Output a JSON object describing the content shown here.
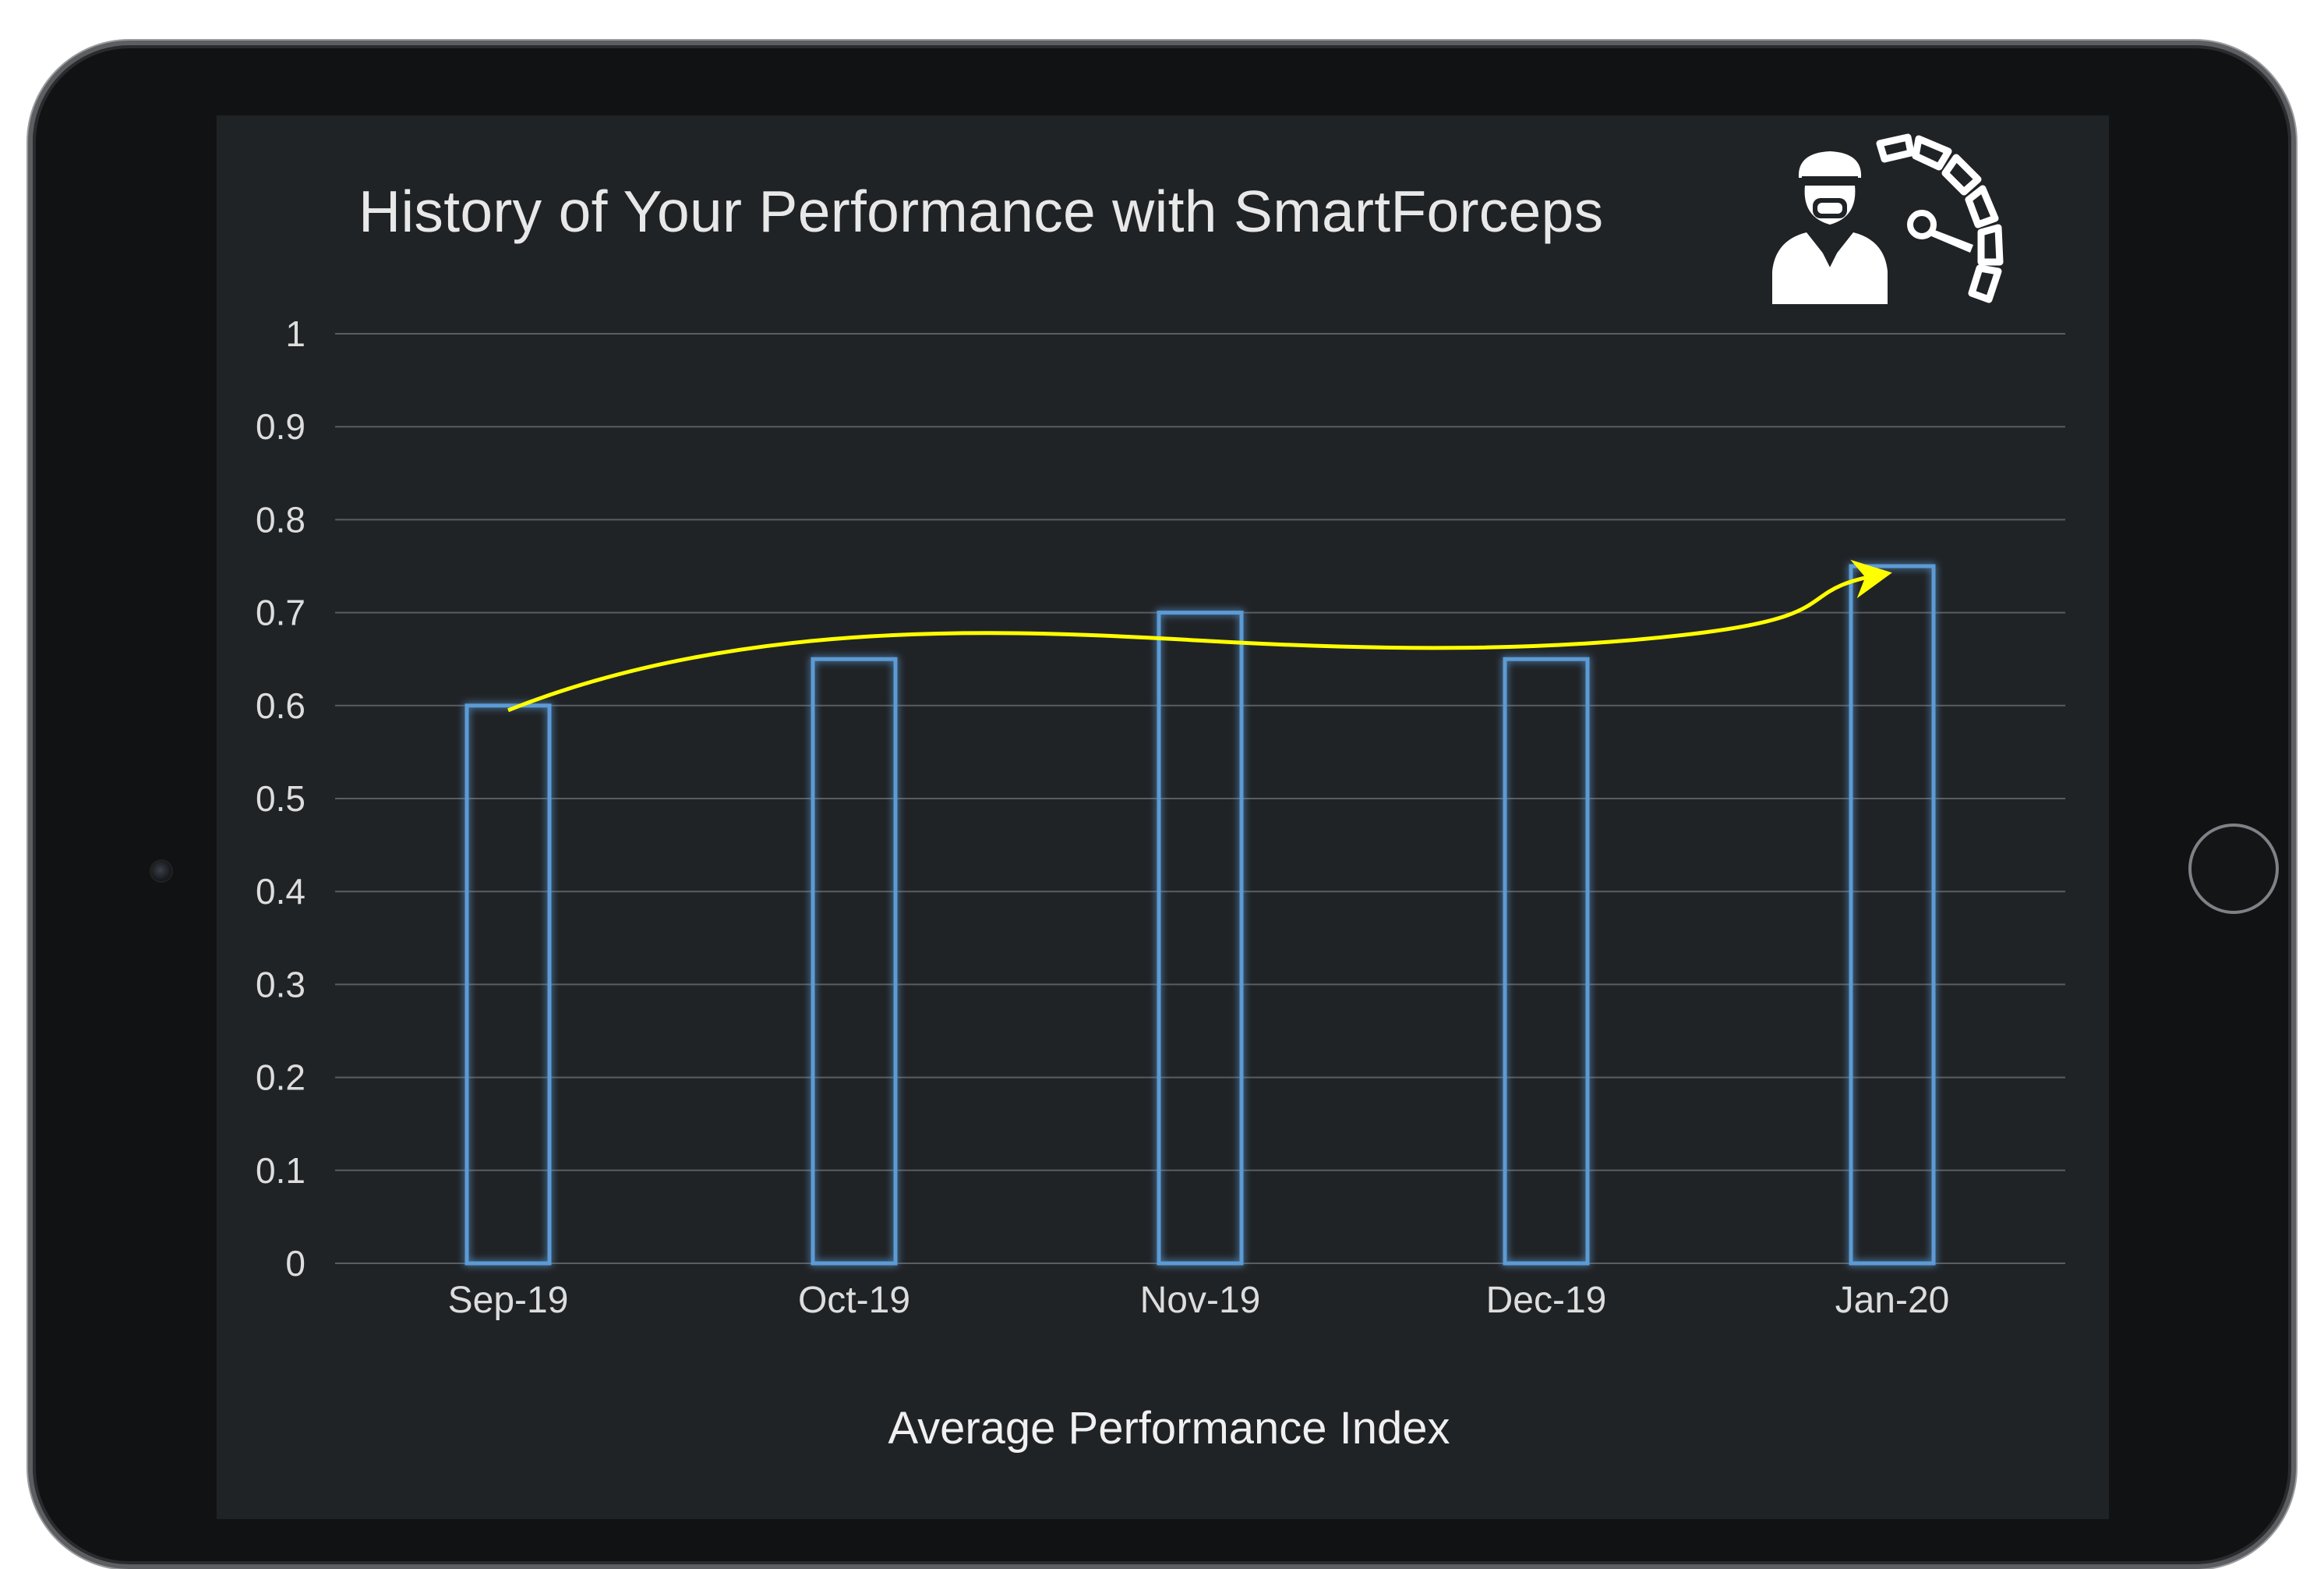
{
  "chart_data": {
    "type": "bar",
    "title": "History of Your Performance with SmartForceps",
    "xlabel": "Average Performance Index",
    "ylabel": "",
    "categories": [
      "Sep-19",
      "Oct-19",
      "Nov-19",
      "Dec-19",
      "Jan-20"
    ],
    "values": [
      0.6,
      0.65,
      0.7,
      0.65,
      0.75
    ],
    "ylim": [
      0,
      1
    ],
    "yticks": [
      "0",
      "0.1",
      "0.2",
      "0.3",
      "0.4",
      "0.5",
      "0.6",
      "0.7",
      "0.8",
      "0.9",
      "1"
    ],
    "grid": true,
    "legend": "none",
    "trend_arrow": true,
    "colors": {
      "bar_outline": "#5b9bd5",
      "trend": "#ffff00",
      "grid": "#5a5d61",
      "background": "#202326"
    }
  },
  "logo": {
    "icon": "surgeon-with-gauge-icon",
    "color": "#ffffff"
  }
}
